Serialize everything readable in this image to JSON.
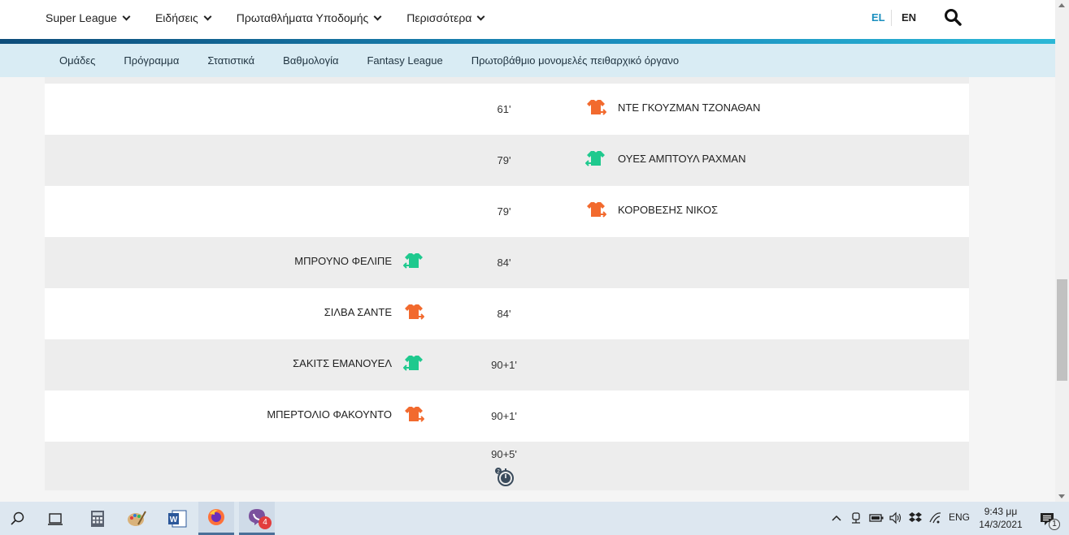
{
  "top_nav": {
    "items": [
      "Super League",
      "Ειδήσεις",
      "Πρωταθλήματα Υποδομής",
      "Περισσότερα"
    ],
    "lang_el": "EL",
    "lang_en": "EN"
  },
  "sub_nav": {
    "items": [
      "Ομάδες",
      "Πρόγραμμα",
      "Στατιστικά",
      "Βαθμολογία",
      "Fantasy League",
      "Πρωτοβάθμιο μονομελές πειθαρχικό όργανο"
    ]
  },
  "events": [
    {
      "minute": "61'",
      "home": "",
      "away": "ΝΤΕ ΓΚΟΥΖΜΑΝ ΤΖΟΝΑΘΑΝ",
      "side": "away",
      "shirt": "out"
    },
    {
      "minute": "79'",
      "home": "",
      "away": "ΟΥΕΣ ΑΜΠΤΟΥΛ ΡΑΧΜΑΝ",
      "side": "away",
      "shirt": "in"
    },
    {
      "minute": "79'",
      "home": "",
      "away": "ΚΟΡΟΒΕΣΗΣ ΝΙΚΟΣ",
      "side": "away",
      "shirt": "out"
    },
    {
      "minute": "84'",
      "home": "ΜΠΡΟΥΝΟ ΦΕΛΙΠΕ",
      "away": "",
      "side": "home",
      "shirt": "in"
    },
    {
      "minute": "84'",
      "home": "ΣΙΛΒΑ ΣΑΝΤΕ",
      "away": "",
      "side": "home",
      "shirt": "out"
    },
    {
      "minute": "90+1'",
      "home": "ΣΑΚΙΤΣ ΕΜΑΝΟΥΕΛ",
      "away": "",
      "side": "home",
      "shirt": "in"
    },
    {
      "minute": "90+1'",
      "home": "ΜΠΕΡΤΟΛΙΟ ΦΑΚΟΥΝΤΟ",
      "away": "",
      "side": "home",
      "shirt": "out"
    },
    {
      "minute": "90+5'",
      "home": "",
      "away": "",
      "side": "none",
      "shirt": "whistle"
    }
  ],
  "colors": {
    "shirt_in": "#1fc98e",
    "shirt_out": "#f26a2e",
    "accent": "#1a8fbf",
    "subnav_bg": "#d9ecf4"
  },
  "taskbar": {
    "tray_lang": "ENG",
    "time": "9:43 μμ",
    "date": "14/3/2021",
    "viber_badge": "4",
    "notif_badge": "1"
  }
}
